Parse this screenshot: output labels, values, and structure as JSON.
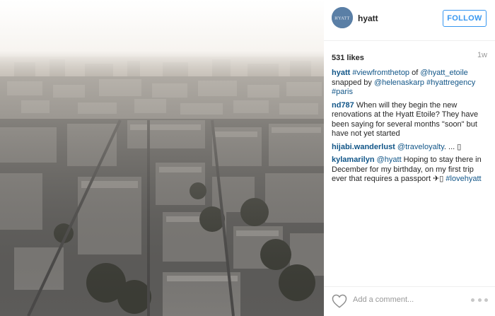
{
  "post": {
    "image_alt": "Aerial view of Paris rooftops from the top",
    "header": {
      "avatar_text": "HYATT",
      "username": "hyatt",
      "follow_label": "FOLLOW"
    },
    "likes": "531 likes",
    "age": "1w",
    "caption": {
      "user": "hyatt",
      "tag1": "#viewfromthetop",
      "text1": " of ",
      "mention1": "@hyatt_etoile",
      "text2": " snapped by ",
      "mention2": "@helenaskarp",
      "text3": " ",
      "tag2": "#hyattregency",
      "text4": " ",
      "tag3": "#paris"
    },
    "comments": [
      {
        "user": "nd787",
        "text": " When will they begin the new renovations at the Hyatt Etoile? They have been saying for several months \"soon\" but have not yet started"
      },
      {
        "user": "hijabi.wanderlust",
        "mention": "@traveloyalty",
        "text": ". ... ▯"
      },
      {
        "user": "kylamarilyn",
        "mention": "@hyatt",
        "text": " Hoping to stay there in December for my birthday, on my first trip ever that requires a passport ✈▯ ",
        "tag": "#lovehyatt"
      }
    ],
    "footer": {
      "add_comment_placeholder": "Add a comment...",
      "heart_icon": "heart-outline-icon",
      "more_icon": "more-options-icon"
    }
  },
  "colors": {
    "link": "#125688",
    "follow": "#3897f0",
    "muted": "#999999"
  }
}
